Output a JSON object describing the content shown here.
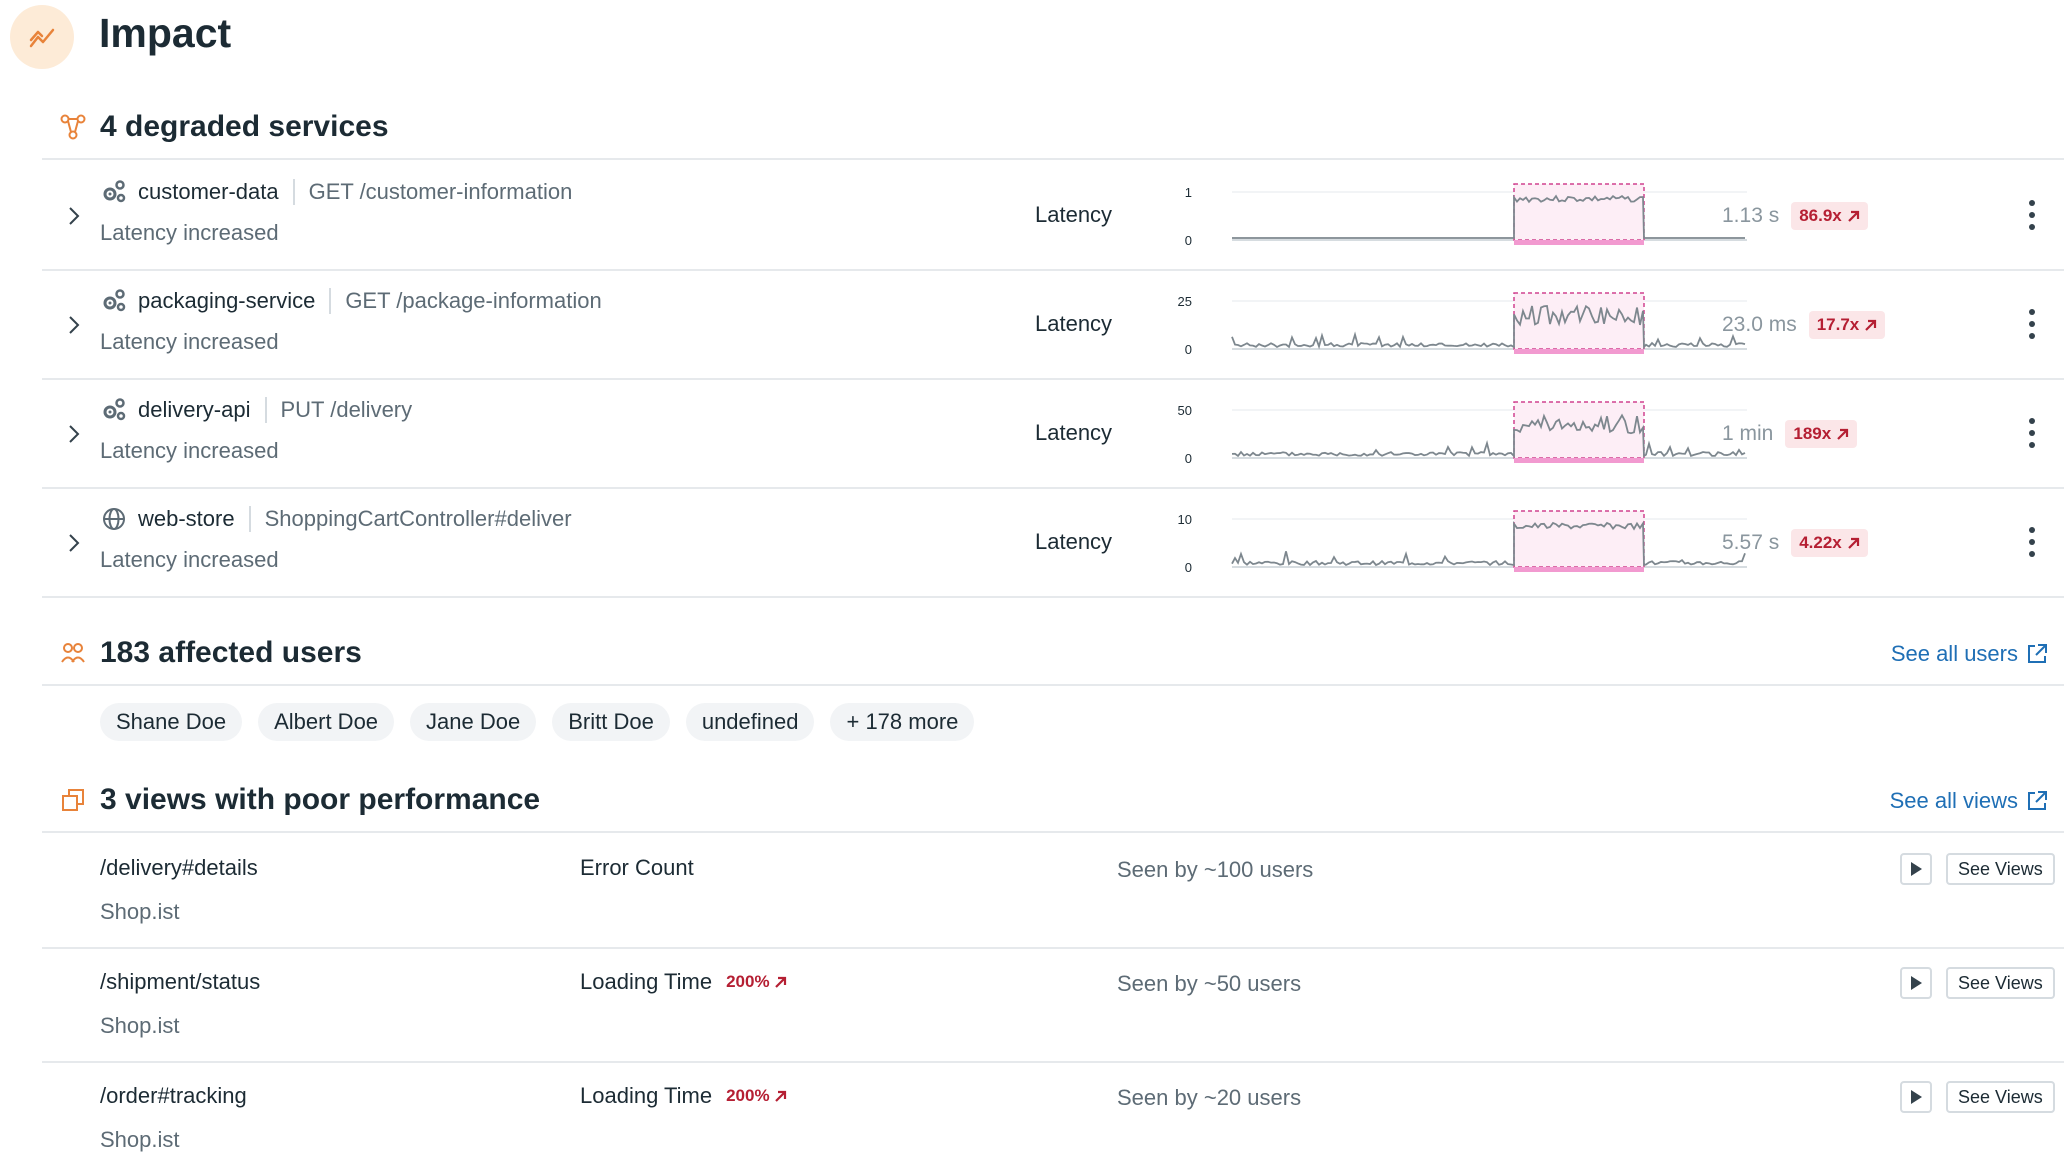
{
  "page": {
    "title": "Impact"
  },
  "services_section": {
    "title": "4 degraded services",
    "rows": [
      {
        "name": "customer-data",
        "resource": "GET /customer-information",
        "status": "Latency increased",
        "metric": "Latency",
        "y_max": "1",
        "y_min": "0",
        "value": "1.13 s",
        "factor": "86.9x",
        "icon": "services-icon"
      },
      {
        "name": "packaging-service",
        "resource": "GET /package-information",
        "status": "Latency increased",
        "metric": "Latency",
        "y_max": "25",
        "y_min": "0",
        "value": "23.0 ms",
        "factor": "17.7x",
        "icon": "services-icon"
      },
      {
        "name": "delivery-api",
        "resource": "PUT /delivery",
        "status": "Latency increased",
        "metric": "Latency",
        "y_max": "50",
        "y_min": "0",
        "value": "1 min",
        "factor": "189x",
        "icon": "services-icon"
      },
      {
        "name": "web-store",
        "resource": "ShoppingCartController#deliver",
        "status": "Latency increased",
        "metric": "Latency",
        "y_max": "10",
        "y_min": "0",
        "value": "5.57 s",
        "factor": "4.22x",
        "icon": "globe-icon"
      }
    ]
  },
  "users_section": {
    "title": "183 affected users",
    "see_all": "See all users",
    "users": [
      "Shane Doe",
      "Albert Doe",
      "Jane Doe",
      "Britt Doe",
      "undefined"
    ],
    "more": "+ 178 more"
  },
  "views_section": {
    "title": "3 views with poor performance",
    "see_all": "See all views",
    "rows": [
      {
        "path": "/delivery#details",
        "app": "Shop.ist",
        "metric": "Error Count",
        "change": "",
        "seen": "Seen by ~100 users",
        "button": "See Views"
      },
      {
        "path": "/shipment/status",
        "app": "Shop.ist",
        "metric": "Loading Time",
        "change": "200%",
        "seen": "Seen by ~50 users",
        "button": "See Views"
      },
      {
        "path": "/order#tracking",
        "app": "Shop.ist",
        "metric": "Loading Time",
        "change": "200%",
        "seen": "Seen by ~20 users",
        "button": "See Views"
      }
    ]
  },
  "colors": {
    "accent_orange": "#e8833a",
    "link_blue": "#1f6fb5",
    "alert_red": "#b51f33",
    "anomaly_pink": "#f29ad0"
  }
}
